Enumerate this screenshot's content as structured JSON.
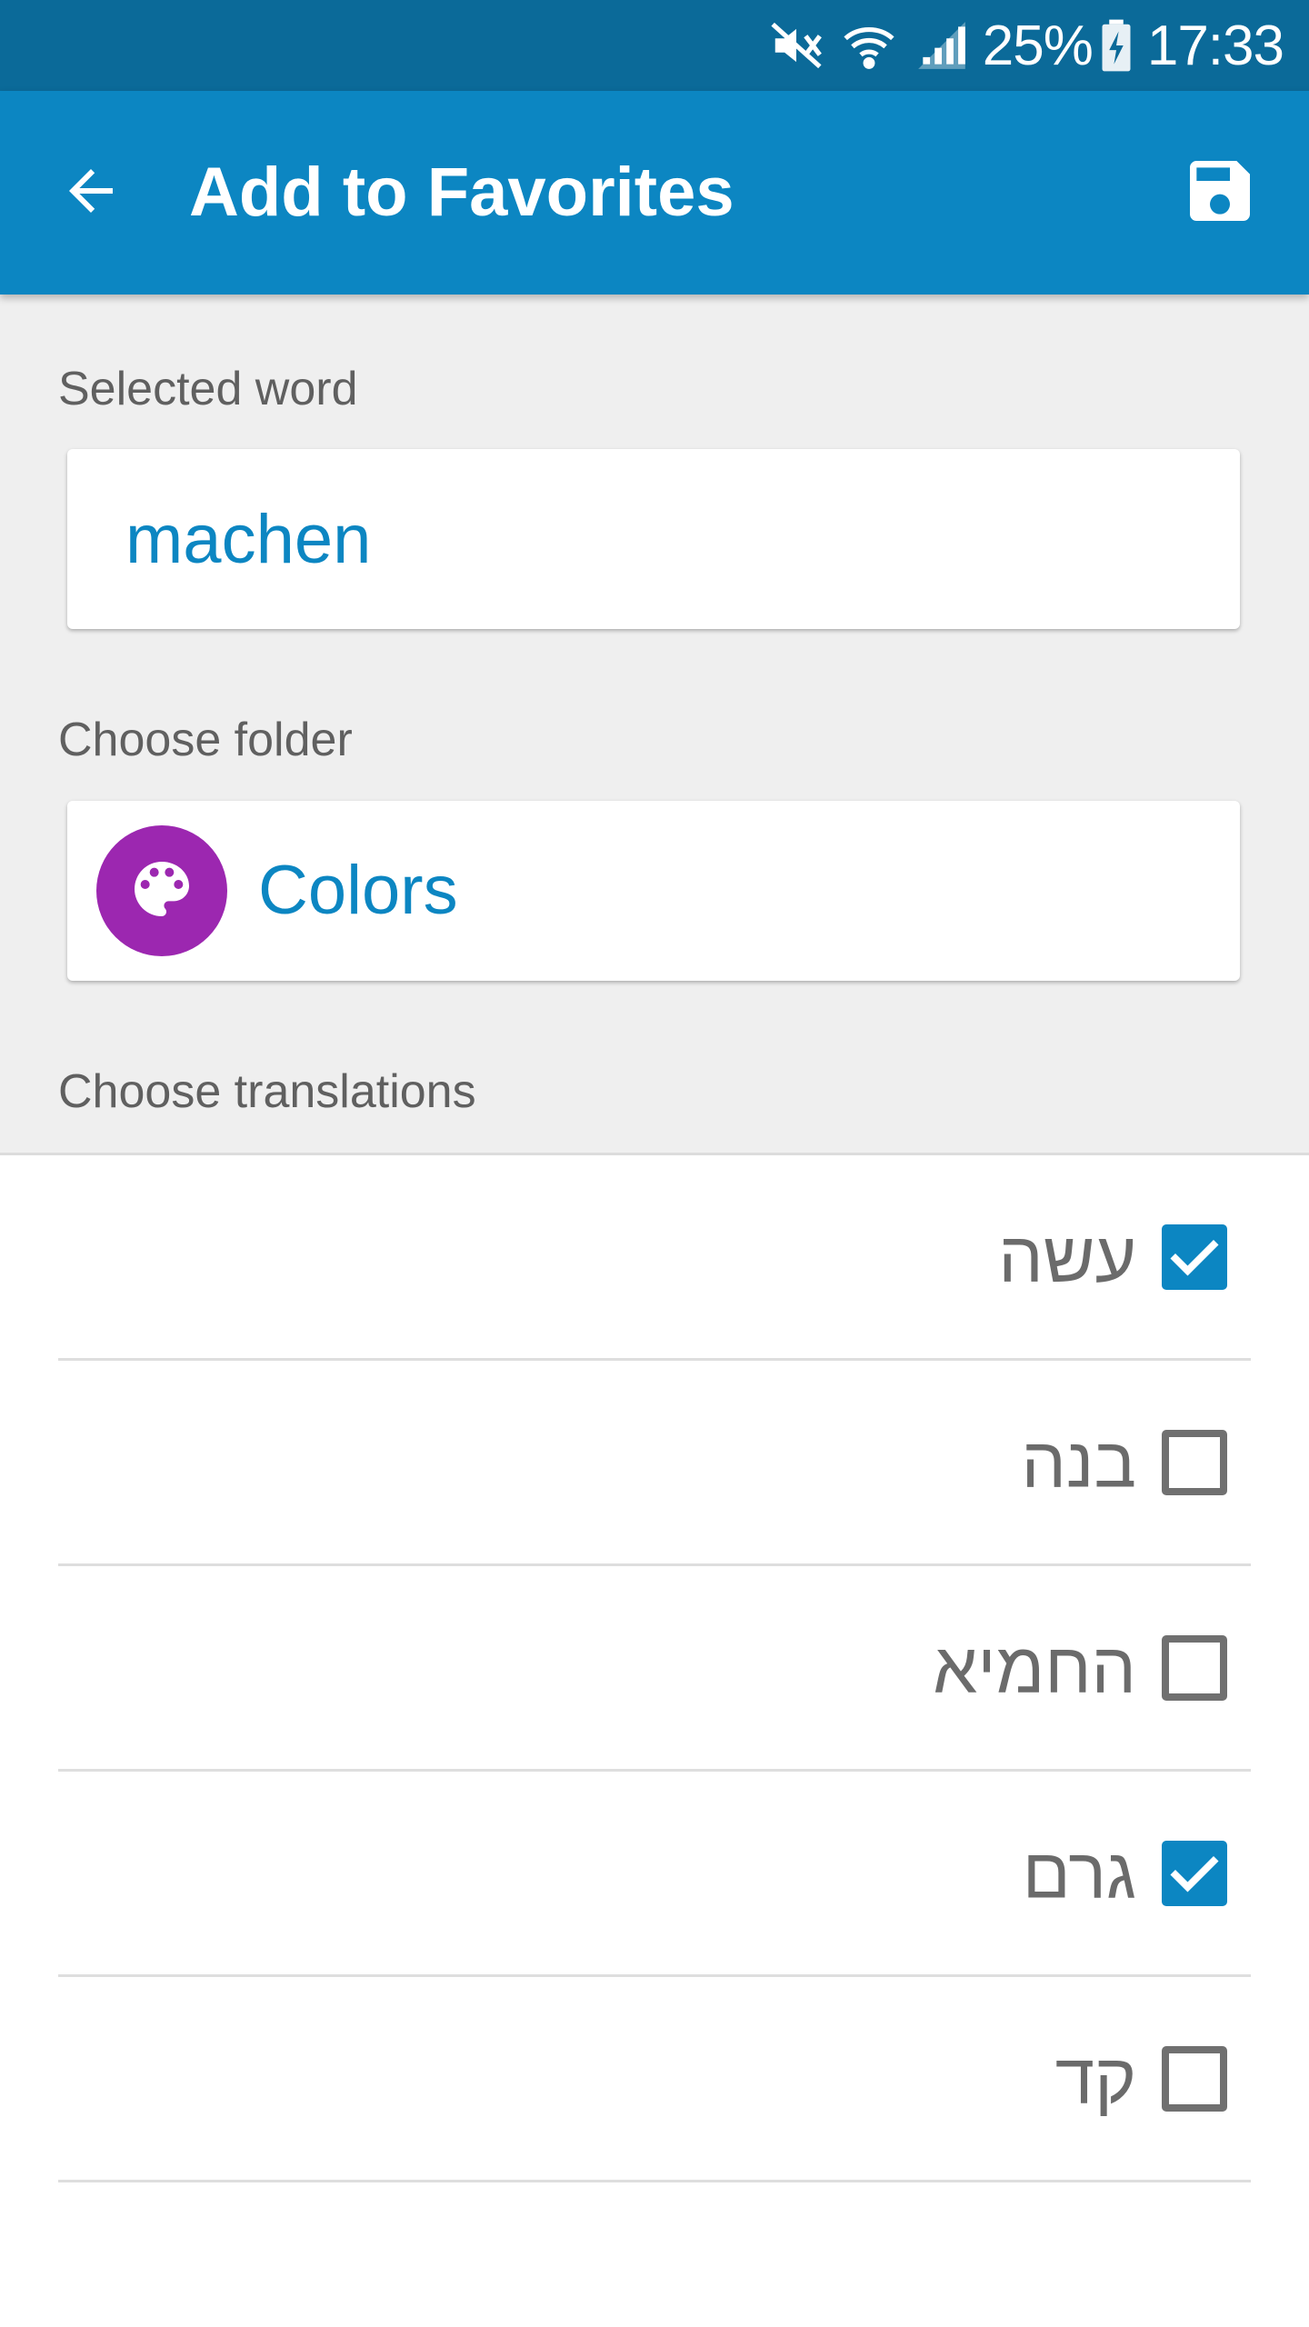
{
  "status_bar": {
    "battery_percent": "25%",
    "time": "17:33",
    "icons": [
      "mute-icon",
      "wifi-icon",
      "signal-icon",
      "battery-charging-icon"
    ]
  },
  "app_bar": {
    "title": "Add to Favorites",
    "back_icon": "arrow-back-icon",
    "save_icon": "save-icon"
  },
  "selected_word": {
    "label": "Selected word",
    "value": "machen"
  },
  "folder": {
    "label": "Choose folder",
    "name": "Colors",
    "icon": "palette-icon",
    "icon_color": "#9c27b0"
  },
  "translations": {
    "label": "Choose translations",
    "items": [
      {
        "text": "עשה",
        "checked": true
      },
      {
        "text": "בנה",
        "checked": false
      },
      {
        "text": "החמיא",
        "checked": false
      },
      {
        "text": "גרם",
        "checked": true
      },
      {
        "text": "קד",
        "checked": false
      }
    ]
  },
  "colors": {
    "accent": "#0c86c2",
    "status_bar": "#0b6a99",
    "background": "#efefef"
  }
}
